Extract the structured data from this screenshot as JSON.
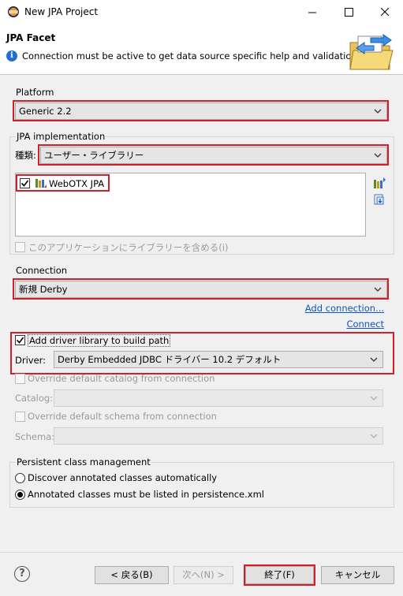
{
  "window": {
    "title": "New JPA Project"
  },
  "header": {
    "page_title": "JPA Facet",
    "message": "Connection must be active to get data source specific help and validation."
  },
  "platform": {
    "label": "Platform",
    "value": "Generic 2.2"
  },
  "jpa_implementation": {
    "group_label": "JPA implementation",
    "type_label": "種類:",
    "type_value": "ユーザー・ライブラリー",
    "libraries": [
      {
        "name": "WebOTX JPA",
        "checked": true
      }
    ],
    "include_label": "このアプリケーションにライブラリーを含める(i)"
  },
  "connection": {
    "label": "Connection",
    "value": "新規 Derby",
    "add_connection": "Add connection...",
    "connect": "Connect",
    "add_driver_label": "Add driver library to build path",
    "driver_label": "Driver:",
    "driver_value": "Derby Embedded JDBC ドライバー 10.2 デフォルト",
    "override_catalog_label": "Override default catalog from connection",
    "catalog_label": "Catalog:",
    "override_schema_label": "Override default schema from connection",
    "schema_label": "Schema:"
  },
  "persistent": {
    "group_label": "Persistent class management",
    "options": [
      {
        "label": "Discover annotated classes automatically",
        "selected": false
      },
      {
        "label": "Annotated classes must be listed in persistence.xml",
        "selected": true
      }
    ]
  },
  "footer": {
    "back": "< 戻る(B)",
    "next": "次へ(N) >",
    "finish": "終了(F)",
    "cancel": "キャンセル"
  },
  "colors": {
    "highlight_box": "#d21f2b",
    "link": "#0b57c5"
  }
}
